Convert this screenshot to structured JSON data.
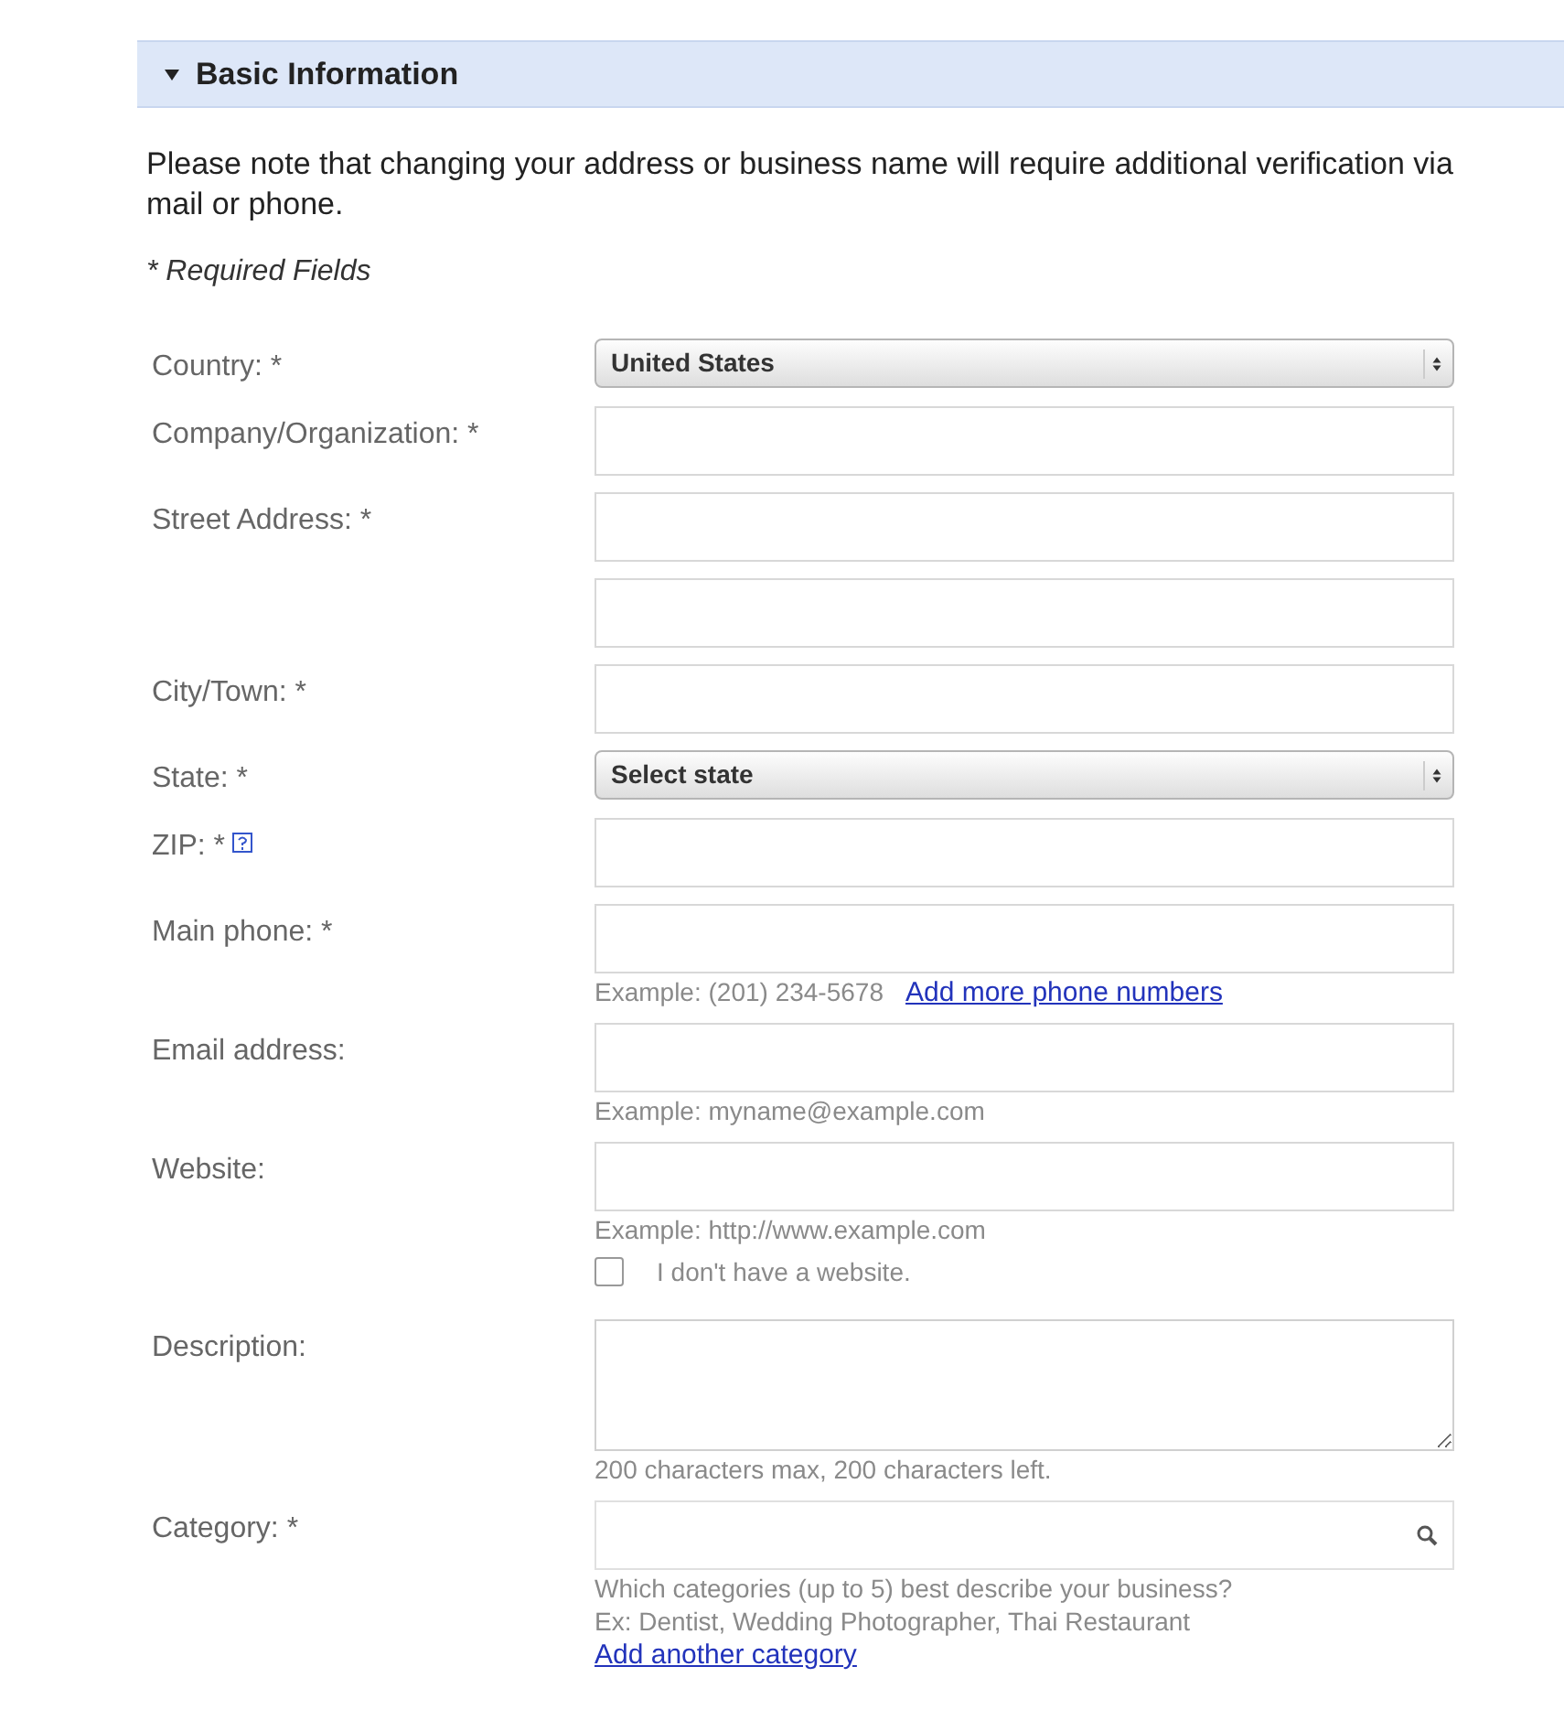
{
  "section": {
    "title": "Basic Information",
    "expanded": true
  },
  "notice": "Please note that changing your address or business name will require additional verification via mail or phone.",
  "required_note": "* Required Fields",
  "rows": [
    {
      "label": "Country: *",
      "control": {
        "kind": "select",
        "value": "United States"
      }
    },
    {
      "label": "Company/Organization: *",
      "control": {
        "kind": "text"
      }
    },
    {
      "label": "Street Address: *",
      "control": {
        "kind": "text"
      }
    },
    {
      "control": {
        "kind": "text"
      }
    },
    {
      "label": "City/Town: *",
      "control": {
        "kind": "text"
      }
    },
    {
      "label": "State: *",
      "control": {
        "kind": "select",
        "value": "Select state"
      }
    },
    {
      "label": "ZIP: *",
      "help": true,
      "control": {
        "kind": "text"
      }
    },
    {
      "label": "Main phone: *",
      "control": {
        "kind": "text"
      },
      "notes": [
        [
          {
            "kind": "text",
            "text": "Example: (201) 234-5678"
          },
          {
            "kind": "link",
            "text": "Add more phone numbers"
          }
        ]
      ]
    },
    {
      "label": "Email address:",
      "control": {
        "kind": "text"
      },
      "notes": [
        [
          {
            "kind": "text",
            "text": "Example: myname@example.com"
          }
        ]
      ]
    },
    {
      "label": "Website:",
      "control": {
        "kind": "text"
      },
      "notes": [
        [
          {
            "kind": "text",
            "text": "Example: http://www.example.com"
          }
        ],
        [
          {
            "kind": "checkbox",
            "text": "I don't have a website.",
            "checked": false
          }
        ]
      ]
    },
    {
      "label": "Description:",
      "control": {
        "kind": "textarea"
      },
      "notes": [
        [
          {
            "kind": "text",
            "text": "200 characters max, 200 characters left."
          }
        ]
      ]
    },
    {
      "label": "Category: *",
      "control": {
        "kind": "search"
      },
      "notes": [
        [
          {
            "kind": "text",
            "text": "Which categories (up to 5) best describe your business?"
          }
        ],
        [
          {
            "kind": "text",
            "text": "Ex: Dentist, Wedding Photographer, Thai Restaurant"
          }
        ],
        [
          {
            "kind": "link",
            "text": "Add another category"
          }
        ]
      ]
    }
  ]
}
